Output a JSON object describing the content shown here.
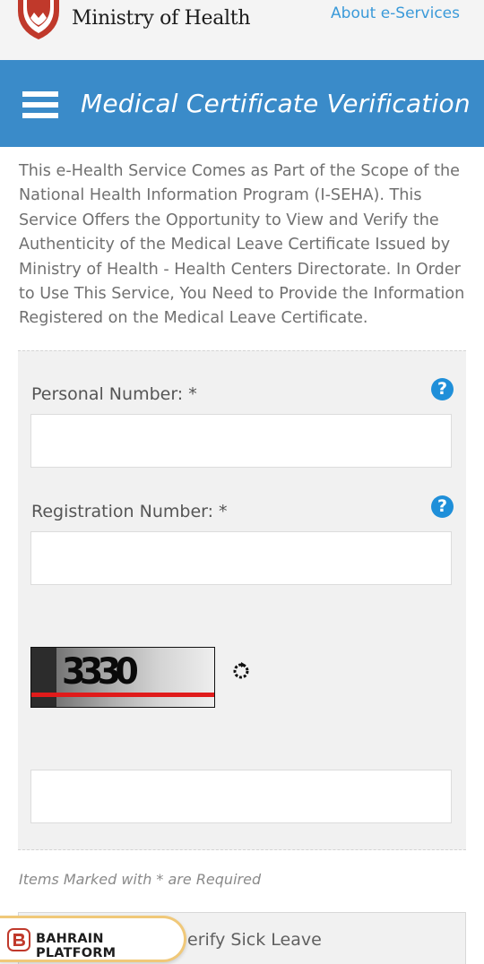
{
  "header": {
    "brand": "Ministry of Health",
    "about_link": "About e-Services"
  },
  "titlebar": {
    "title": "Medical Certificate Verification"
  },
  "intro": {
    "text": "This e-Health Service Comes as Part of the Scope of the National Health Information Program (I-SEHA). This Service Offers the Opportunity to View and Verify the Authenticity of the Medical Leave Certificate Issued by Ministry of Health - Health Centers Directorate. In Order to Use This Service, You Need to Provide the Information Registered on the Medical Leave Certificate."
  },
  "form": {
    "personal_number_label": "Personal Number: *",
    "personal_number_value": "",
    "registration_number_label": "Registration Number: *",
    "registration_number_value": "",
    "captcha_text": "3330",
    "captcha_input_value": "",
    "help_glyph": "?"
  },
  "note": "Items Marked with * are Required",
  "submit": {
    "label": "erify Sick Leave"
  },
  "badge": {
    "label": "BAHRAIN PLATFORM"
  },
  "colors": {
    "titlebar": "#3a8bc9",
    "link": "#3a9ad9",
    "help_icon": "#1f8fd9",
    "badge_border": "#f0c879",
    "captcha_stripe": "#e01b1b"
  },
  "icons": {
    "menu": "hamburger-menu-icon",
    "help": "question-circle-icon",
    "refresh": "refresh-icon",
    "emblem": "ministry-emblem-icon",
    "badge_logo": "bahrain-platform-logo-icon"
  }
}
